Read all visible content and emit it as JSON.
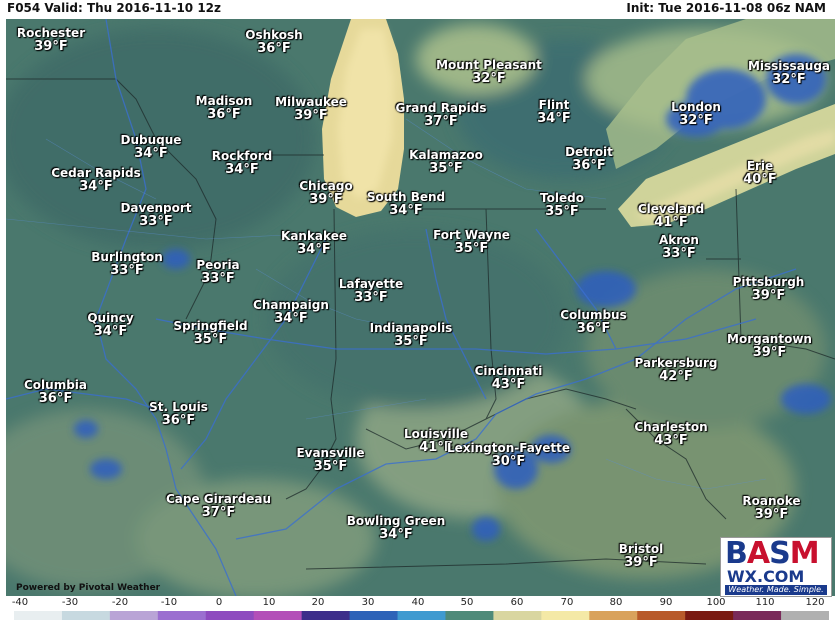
{
  "header": {
    "left_text": "F054 Valid: Thu 2016-11-10 12z",
    "right_text": "Init: Tue 2016-11-08 06z NAM"
  },
  "cities": [
    {
      "name": "Rochester",
      "temp": "39°F"
    },
    {
      "name": "Oshkosh",
      "temp": "36°F"
    },
    {
      "name": "Mount Pleasant",
      "temp": "32°F"
    },
    {
      "name": "Mississauga",
      "temp": "32°F"
    },
    {
      "name": "Madison",
      "temp": "36°F"
    },
    {
      "name": "Milwaukee",
      "temp": "39°F"
    },
    {
      "name": "Grand Rapids",
      "temp": "37°F"
    },
    {
      "name": "Flint",
      "temp": "34°F"
    },
    {
      "name": "London",
      "temp": "32°F"
    },
    {
      "name": "Dubuque",
      "temp": "34°F"
    },
    {
      "name": "Rockford",
      "temp": "34°F"
    },
    {
      "name": "Kalamazoo",
      "temp": "35°F"
    },
    {
      "name": "Detroit",
      "temp": "36°F"
    },
    {
      "name": "Erie",
      "temp": "40°F"
    },
    {
      "name": "Cedar Rapids",
      "temp": "34°F"
    },
    {
      "name": "Chicago",
      "temp": "39°F"
    },
    {
      "name": "South Bend",
      "temp": "34°F"
    },
    {
      "name": "Toledo",
      "temp": "35°F"
    },
    {
      "name": "Cleveland",
      "temp": "41°F"
    },
    {
      "name": "Davenport",
      "temp": "33°F"
    },
    {
      "name": "Kankakee",
      "temp": "34°F"
    },
    {
      "name": "Fort Wayne",
      "temp": "35°F"
    },
    {
      "name": "Akron",
      "temp": "33°F"
    },
    {
      "name": "Burlington",
      "temp": "33°F"
    },
    {
      "name": "Peoria",
      "temp": "33°F"
    },
    {
      "name": "Lafayette",
      "temp": "33°F"
    },
    {
      "name": "Pittsburgh",
      "temp": "39°F"
    },
    {
      "name": "Champaign",
      "temp": "34°F"
    },
    {
      "name": "Quincy",
      "temp": "34°F"
    },
    {
      "name": "Springfield",
      "temp": "35°F"
    },
    {
      "name": "Columbus",
      "temp": "36°F"
    },
    {
      "name": "Indianapolis",
      "temp": "35°F"
    },
    {
      "name": "Morgantown",
      "temp": "39°F"
    },
    {
      "name": "Parkersburg",
      "temp": "42°F"
    },
    {
      "name": "Columbia",
      "temp": "36°F"
    },
    {
      "name": "Cincinnati",
      "temp": "43°F"
    },
    {
      "name": "St. Louis",
      "temp": "36°F"
    },
    {
      "name": "Charleston",
      "temp": "43°F"
    },
    {
      "name": "Louisville",
      "temp": "41°F"
    },
    {
      "name": "Lexington-Fayette",
      "temp": "30°F"
    },
    {
      "name": "Evansville",
      "temp": "35°F"
    },
    {
      "name": "Cape Girardeau",
      "temp": "37°F"
    },
    {
      "name": "Roanoke",
      "temp": "39°F"
    },
    {
      "name": "Bowling Green",
      "temp": "34°F"
    },
    {
      "name": "Bristol",
      "temp": "39°F"
    }
  ],
  "footer": {
    "powered_by": "Powered by Pivotal Weather"
  },
  "scale": {
    "labels": [
      "-40",
      "-30",
      "-20",
      "-10",
      "0",
      "10",
      "20",
      "30",
      "40",
      "50",
      "60",
      "70",
      "80",
      "90",
      "100",
      "110",
      "120"
    ],
    "colors": [
      "#e8eef0",
      "#c7d9e0",
      "#b9a4d6",
      "#9b6fd0",
      "#8e4bbf",
      "#b34fb8",
      "#3d2e8a",
      "#2d63b8",
      "#3f9ad0",
      "#4e8a79",
      "#d9d6a0",
      "#f4e9a6",
      "#d9a25c",
      "#b85a2a",
      "#7a1a12",
      "#7a2a5a",
      "#b0b0b0"
    ]
  },
  "logo": {
    "letters": [
      "B",
      "A",
      "S",
      "M"
    ],
    "wx": "WX.COM",
    "tagline": "Weather. Made. Simple."
  }
}
